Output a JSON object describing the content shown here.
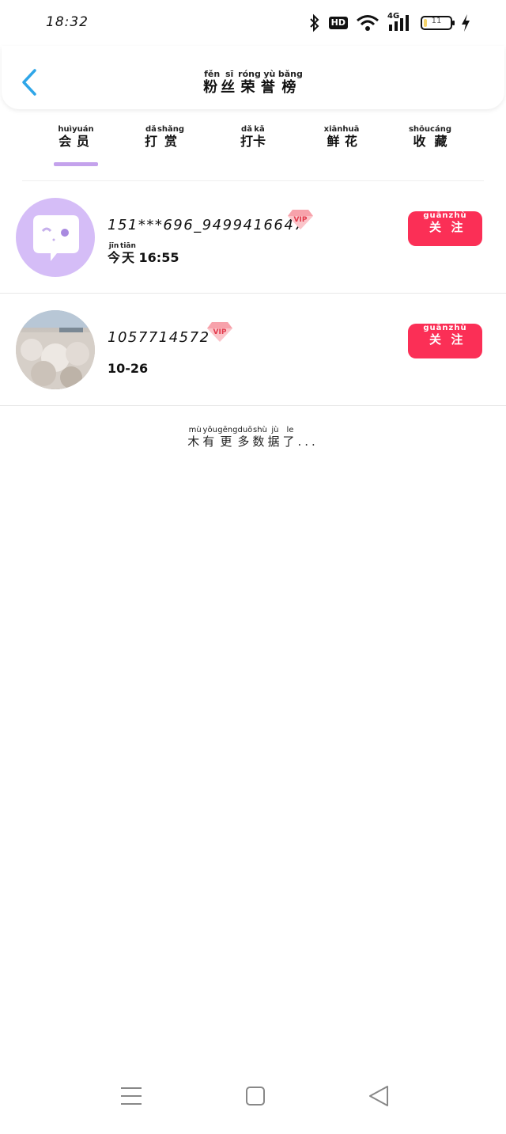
{
  "status_bar": {
    "time": "18:32",
    "network": "4G",
    "hd_label": "HD",
    "battery_text": "11",
    "battery_percent": 11
  },
  "header": {
    "title_chars": [
      "粉",
      "丝",
      "荣",
      "誉",
      "榜"
    ],
    "title_pinyin": [
      "fěn",
      "sī",
      "róng",
      "yù",
      "bǎng"
    ]
  },
  "tabs": [
    {
      "chars": [
        "会",
        "员"
      ],
      "pinyin": [
        "huì",
        "yuán"
      ],
      "active": true
    },
    {
      "chars": [
        "打",
        "赏"
      ],
      "pinyin": [
        "dǎ",
        "shǎng"
      ],
      "active": false
    },
    {
      "chars": [
        "打",
        "卡"
      ],
      "pinyin": [
        "dǎ",
        "kǎ"
      ],
      "active": false
    },
    {
      "chars": [
        "鲜",
        "花"
      ],
      "pinyin": [
        "xiān",
        "huā"
      ],
      "active": false
    },
    {
      "chars": [
        "收",
        "藏"
      ],
      "pinyin": [
        "shōu",
        "cáng"
      ],
      "active": false
    }
  ],
  "accent_color": "#c4a2ec",
  "follow_color": "#fb2f56",
  "members": [
    {
      "username": "151***696_9499416647",
      "time_prefix_chars": [
        "今",
        "天"
      ],
      "time_prefix_pinyin": [
        "jīn",
        "tiān"
      ],
      "time": " 16:55",
      "vip_label": "VIP",
      "follow_chars": [
        "关",
        "注"
      ],
      "follow_pinyin": [
        "guān",
        "zhù"
      ]
    },
    {
      "username": "1057714572",
      "time_prefix_chars": [],
      "time_prefix_pinyin": [],
      "time": "10-26",
      "vip_label": "VIP",
      "follow_chars": [
        "关",
        "注"
      ],
      "follow_pinyin": [
        "guān",
        "zhù"
      ]
    }
  ],
  "footer": {
    "chars": [
      "木",
      "有",
      "更",
      "多",
      "数",
      "据",
      "了"
    ],
    "pinyin": [
      "mù",
      "yǒu",
      "gēng",
      "duō",
      "shù",
      "jù",
      "le"
    ],
    "suffix": "..."
  }
}
